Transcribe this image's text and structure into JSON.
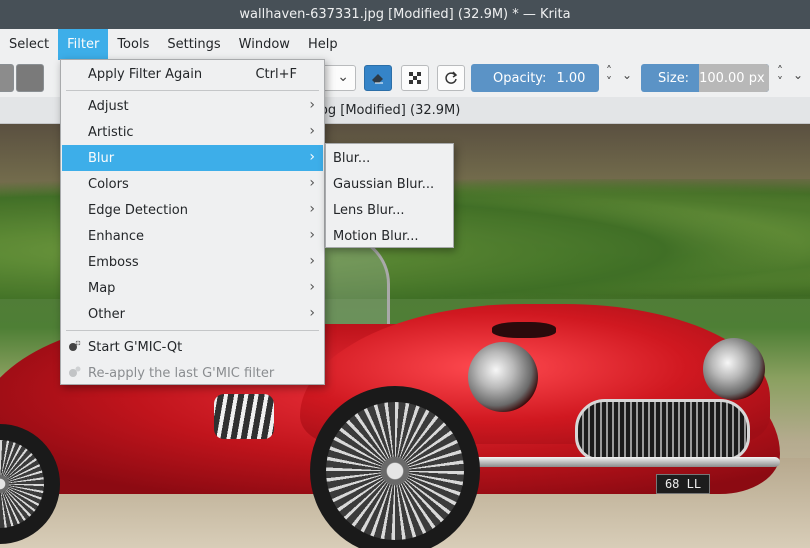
{
  "window": {
    "title": "wallhaven-637331.jpg [Modified] (32.9M) * — Krita"
  },
  "menubar": {
    "items": [
      "Select",
      "Filter",
      "Tools",
      "Settings",
      "Window",
      "Help"
    ],
    "active": "Filter"
  },
  "toolbar": {
    "opacity_label": "Opacity:",
    "opacity_value": "1.00",
    "size_label": "Size:",
    "size_value": "100.00 px"
  },
  "document_tab": {
    "title": "jpg [Modified]  (32.9M)"
  },
  "filter_menu": {
    "apply_again": {
      "label": "Apply Filter Again",
      "shortcut": "Ctrl+F"
    },
    "categories": [
      "Adjust",
      "Artistic",
      "Blur",
      "Colors",
      "Edge Detection",
      "Enhance",
      "Emboss",
      "Map",
      "Other"
    ],
    "highlighted": "Blur",
    "gmic_start": "Start G'MIC-Qt",
    "gmic_reapply": "Re-apply the last G'MIC filter"
  },
  "blur_submenu": {
    "items": [
      "Blur...",
      "Gaussian Blur...",
      "Lens Blur...",
      "Motion Blur..."
    ]
  },
  "canvas": {
    "plate_text": "68 LL"
  },
  "colors": {
    "accent": "#3daee9",
    "titlebar": "#475057",
    "menu_bg": "#eff0f1"
  }
}
